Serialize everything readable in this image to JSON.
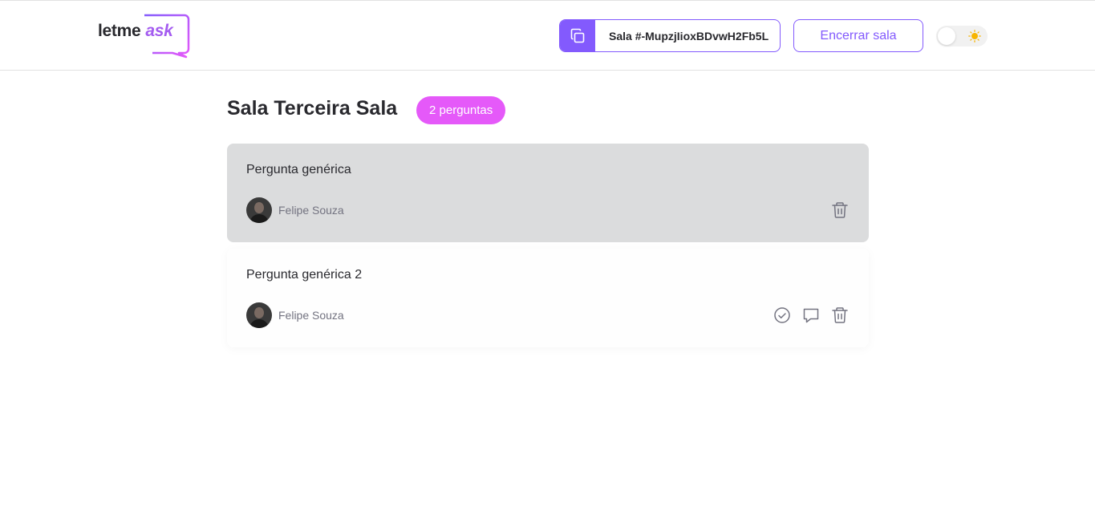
{
  "header": {
    "logo": {
      "text_main": "letme",
      "text_accent": "ask"
    },
    "room_code": {
      "label": "Sala #-MupzjIioxBDvwH2Fb5L",
      "icon": "copy-icon"
    },
    "close_room_label": "Encerrar sala",
    "theme_toggle": {
      "icon": "sun-icon",
      "state": "light"
    }
  },
  "room": {
    "title": "Sala Terceira Sala",
    "question_count_label": "2 perguntas"
  },
  "questions": [
    {
      "content": "Pergunta genérica",
      "author": "Felipe Souza",
      "highlighted": true,
      "actions": [
        "trash-icon"
      ]
    },
    {
      "content": "Pergunta genérica 2",
      "author": "Felipe Souza",
      "highlighted": false,
      "actions": [
        "check-circle-icon",
        "answer-icon",
        "trash-icon"
      ]
    }
  ],
  "colors": {
    "primary": "#835afd",
    "pink": "#e559f9",
    "highlight_bg": "#dbdcdd",
    "text": "#29292e",
    "muted": "#737380"
  }
}
